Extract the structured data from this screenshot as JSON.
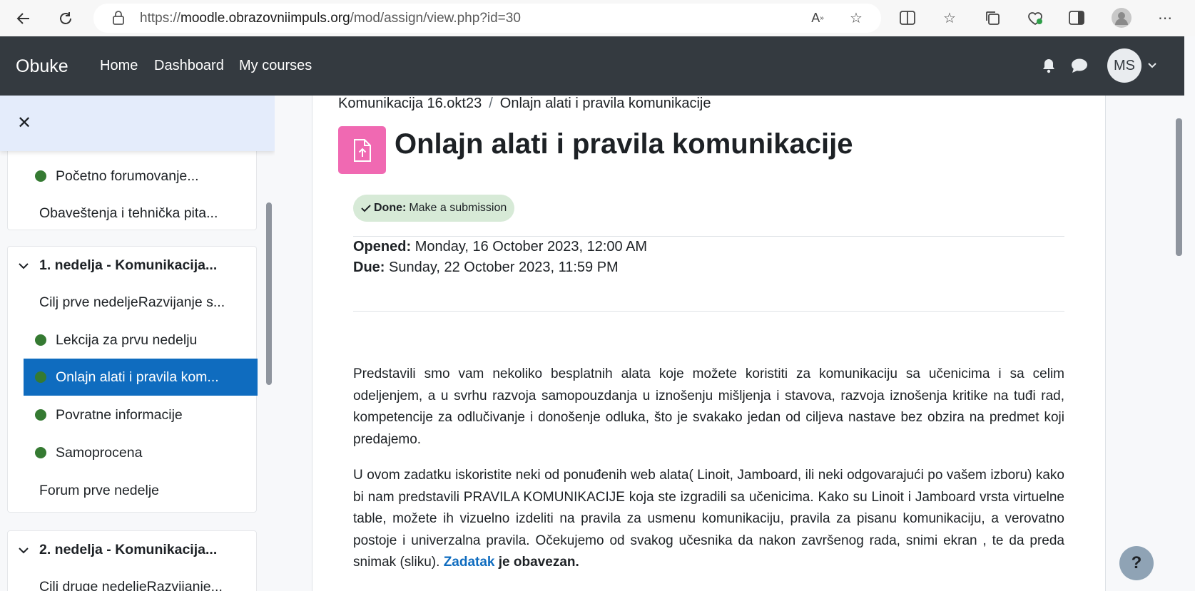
{
  "browser": {
    "url_prefix": "https://",
    "url_domain": "moodle.obrazovniimpuls.org",
    "url_path": "/mod/assign/view.php?id=30"
  },
  "navbar": {
    "brand": "Obuke",
    "links": [
      "Home",
      "Dashboard",
      "My courses"
    ],
    "avatar_initials": "MS"
  },
  "drawer": {
    "top_items": [
      {
        "label": "Početno forumovanje...",
        "status": "done"
      },
      {
        "label": "Obaveštenja i tehnička pita...",
        "status": "none"
      }
    ],
    "section1": {
      "title": "1. nedelja - Komunikacija...",
      "items": [
        {
          "label": "Cilj prve nedeljeRazvijanje s...",
          "status": "none"
        },
        {
          "label": "Lekcija za prvu nedelju",
          "status": "done"
        },
        {
          "label": "Onlajn alati i pravila kom...",
          "status": "done",
          "active": true
        },
        {
          "label": "Povratne informacije",
          "status": "done"
        },
        {
          "label": "Samoprocena",
          "status": "done"
        },
        {
          "label": "Forum prve nedelje",
          "status": "none"
        }
      ]
    },
    "section2": {
      "title": "2. nedelja - Komunikacija...",
      "items": [
        {
          "label": "Cilj druge nedeljeRazvijanje...",
          "status": "none"
        }
      ]
    }
  },
  "main": {
    "breadcrumb": [
      "Komunikacija 16.okt23",
      "Onlajn alati i pravila komunikacije"
    ],
    "breadcrumb_separator": "/",
    "title": "Onlajn alati i pravila komunikacije",
    "completion": {
      "label": "Done:",
      "text": "Make a submission"
    },
    "opened_label": "Opened:",
    "opened_value": "Monday, 16 October 2023, 12:00 AM",
    "due_label": "Due:",
    "due_value": "Sunday, 22 October 2023, 11:59 PM",
    "paragraph1": "Predstavili smo vam nekoliko besplatnih alata koje možete koristiti za komunikaciju sa učenicima i sa celim odeljenjem, a u svrhu razvoja samopouzdanja u iznošenju  mišljenja i stavova, razvoja iznošenja kritike na tuđi rad, kompetencije za odlučivanje i donošenje odluka, što je svakako jedan od ciljeva nastave bez obzira na predmet koji predajemo.",
    "paragraph2": "U ovom zadatku  iskoristite neki od ponuđenih web alata( Linoit, Jamboard, ili neki odgovarajući po vašem izboru)  kako bi nam predstavili PRAVILA KOMUNIKACIJE  koja ste  izgradili sa učenicima. Kako su Linoit i Jamboard  vrsta virtuelne table, možete ih vizuelno izdeliti na pravila za usmenu komunikaciju, pravila za pisanu komunikaciju, a verovatno postoje i univerzalna pravila. Očekujemo od svakog učesnika da nakon završenog rada, snimi ekran , te da preda snimak (sliku). ",
    "paragraph2_link": "Zadatak",
    "paragraph2_bold": " je obavezan."
  },
  "help_button": "?",
  "colors": {
    "navbar": "#343a40",
    "active": "#0f6cbf",
    "done_dot": "#357a32",
    "assign_icon": "#f069b2",
    "badge": "#d7ead7"
  }
}
